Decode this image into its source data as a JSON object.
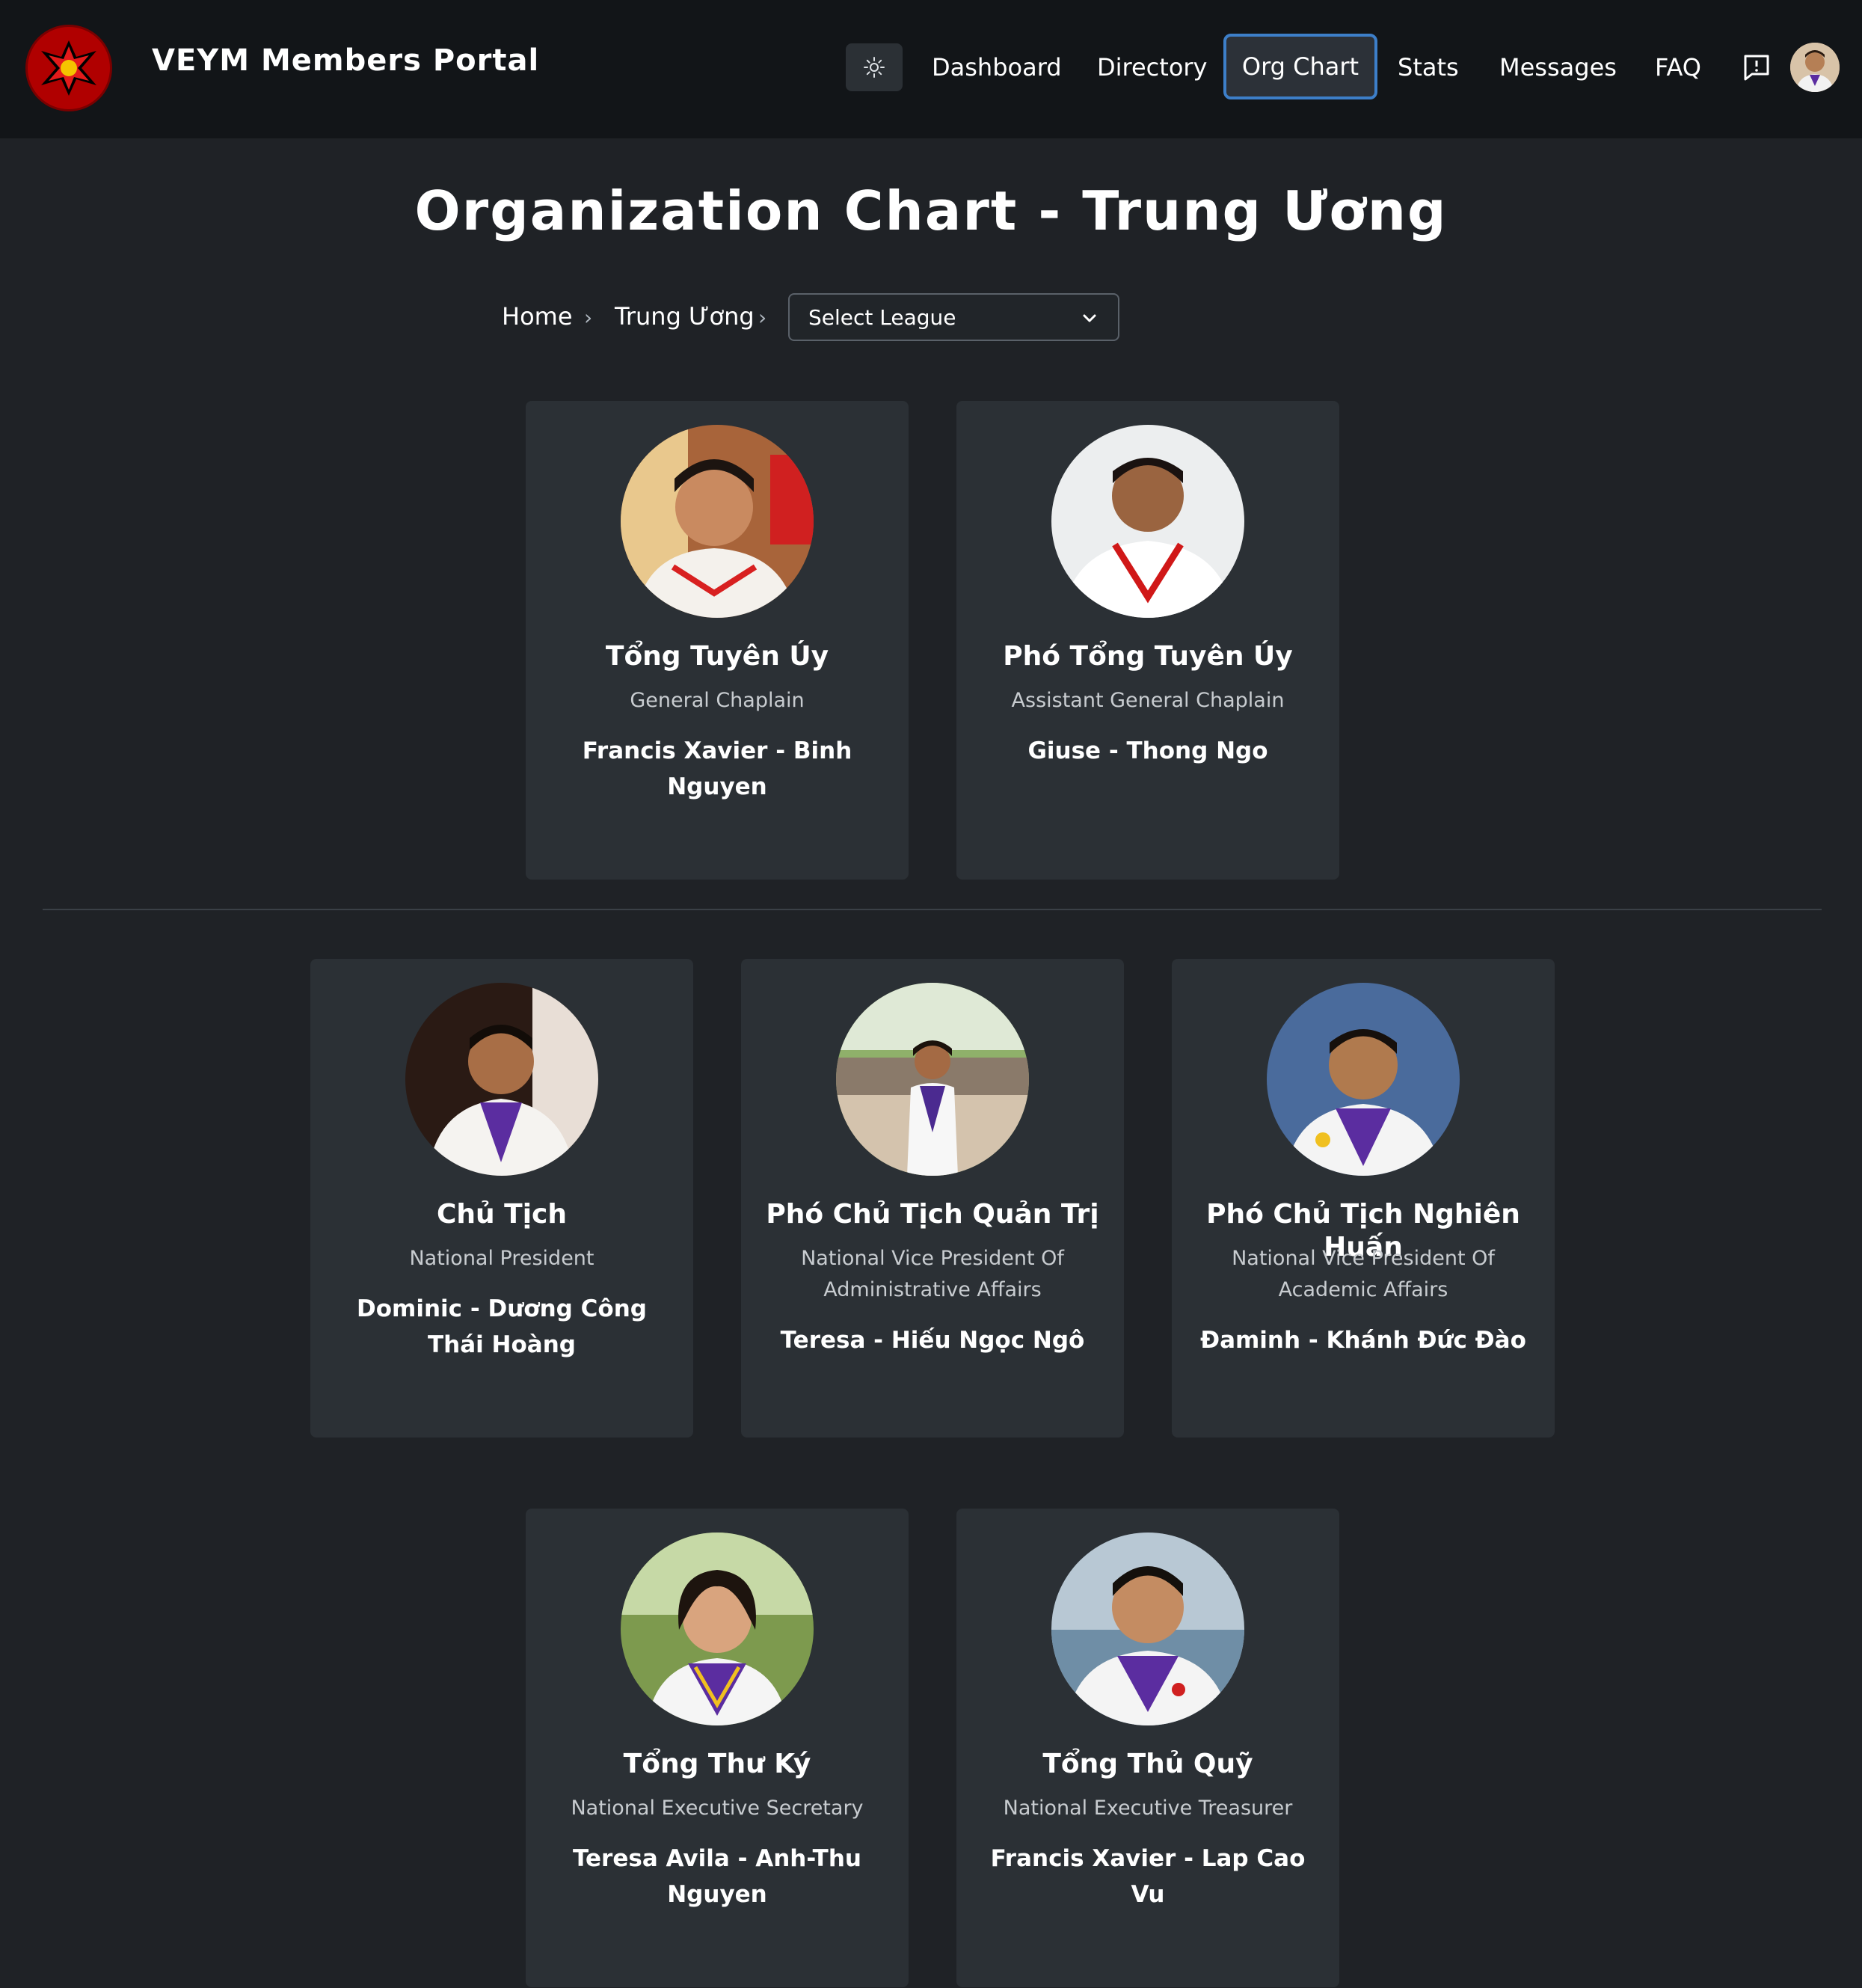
{
  "header": {
    "brand": "VEYM Members Portal",
    "nav": {
      "dashboard": "Dashboard",
      "directory": "Directory",
      "org_chart": "Org Chart",
      "stats": "Stats",
      "messages": "Messages",
      "faq": "FAQ"
    },
    "active_nav": "Org Chart",
    "accent_color": "#3d7fc9",
    "icons": [
      "logo",
      "sun-icon",
      "feedback-icon",
      "user-avatar"
    ]
  },
  "page": {
    "title": "Organization Chart - Trung Ương",
    "breadcrumb": {
      "home": "Home",
      "current": "Trung Ương"
    },
    "league_select": {
      "selected": "Select League"
    }
  },
  "chaplains": [
    {
      "role_vn": "Tổng Tuyên Úy",
      "role_en": "General Chaplain",
      "name": "Francis Xavier - Binh Nguyen"
    },
    {
      "role_vn": "Phó Tổng Tuyên Úy",
      "role_en": "Assistant General Chaplain",
      "name": "Giuse - Thong Ngo"
    }
  ],
  "executives": [
    {
      "role_vn": "Chủ Tịch",
      "role_en": "National President",
      "name": "Dominic - Dương Công Thái Hoàng"
    },
    {
      "role_vn": "Phó Chủ Tịch Quản Trị",
      "role_en": "National Vice President Of Administrative Affairs",
      "name": "Teresa - Hiếu Ngọc Ngô"
    },
    {
      "role_vn": "Phó Chủ Tịch Nghiên Huấn",
      "role_en": "National Vice President Of Academic Affairs",
      "name": "Đaminh - Khánh Đức Đào"
    }
  ],
  "officers": [
    {
      "role_vn": "Tổng Thư Ký",
      "role_en": "National Executive Secretary",
      "name": "Teresa Avila - Anh-Thu Nguyen"
    },
    {
      "role_vn": "Tổng Thủ Quỹ",
      "role_en": "National Executive Treasurer",
      "name": "Francis Xavier - Lap Cao Vu"
    }
  ]
}
